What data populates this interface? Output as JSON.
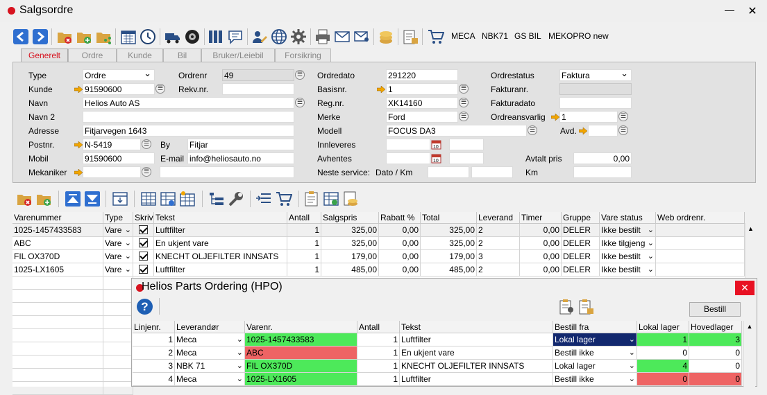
{
  "app": {
    "title": "Salgsordre",
    "min": "—",
    "close": "✕"
  },
  "toolbar": {
    "texts": [
      "MECA",
      "NBK71",
      "GS BIL",
      "MEKOPRO new"
    ]
  },
  "tabs": [
    "Generelt",
    "Ordre",
    "Kunde",
    "Bil",
    "Bruker/Leiebil",
    "Forsikring"
  ],
  "form": {
    "type_label": "Type",
    "type_value": "Ordre",
    "ordrenr_label": "Ordrenr",
    "ordrenr_value": "49",
    "kunde_label": "Kunde",
    "kunde_value": "91590600",
    "rekvnr_label": "Rekv.nr.",
    "rekvnr_value": "",
    "navn_label": "Navn",
    "navn_value": "Helios Auto AS",
    "navn2_label": "Navn 2",
    "navn2_value": "",
    "adresse_label": "Adresse",
    "adresse_value": "Fitjarvegen 1643",
    "postnr_label": "Postnr.",
    "postnr_value": "N-5419",
    "by_label": "By",
    "by_value": "Fitjar",
    "mobil_label": "Mobil",
    "mobil_value": "91590600",
    "email_label": "E-mail",
    "email_value": "info@heliosauto.no",
    "mekaniker_label": "Mekaniker",
    "mekaniker_value": "",
    "ordredato_label": "Ordredato",
    "ordredato_value": "291220",
    "basisnr_label": "Basisnr.",
    "basisnr_value": "1",
    "regnr_label": "Reg.nr.",
    "regnr_value": "XK14160",
    "merke_label": "Merke",
    "merke_value": "Ford",
    "modell_label": "Modell",
    "modell_value": "FOCUS DA3",
    "innleveres_label": "Innleveres",
    "avhentes_label": "Avhentes",
    "neste_label": "Neste service:",
    "neste_sub": "Dato / Km",
    "ordrestatus_label": "Ordrestatus",
    "ordrestatus_value": "Faktura",
    "fakturanr_label": "Fakturanr.",
    "fakturanr_value": "",
    "fakturadato_label": "Fakturadato",
    "fakturadato_value": "",
    "ordreansvarlig_label": "Ordreansvarlig",
    "ordreansvarlig_value": "1",
    "avd_label": "Avd.",
    "avd_value": "",
    "avtalt_label": "Avtalt pris",
    "avtalt_value": "0,00",
    "km_label": "Km",
    "km_value": ""
  },
  "grid": {
    "headers": [
      "Varenummer",
      "Type",
      "Skriv",
      "Tekst",
      "Antall",
      "Salgspris",
      "Rabatt %",
      "Total",
      "Leverand",
      "Timer",
      "Gruppe",
      "Vare status",
      "Web ordrenr."
    ],
    "rows": [
      [
        "1025-1457433583",
        "Vare",
        "",
        "Luftfilter",
        "1",
        "325,00",
        "0,00",
        "325,00",
        "2",
        "0,00",
        "DELER",
        "Ikke bestilt",
        ""
      ],
      [
        "ABC",
        "Vare",
        "",
        "En ukjent vare",
        "1",
        "325,00",
        "0,00",
        "325,00",
        "2",
        "0,00",
        "DELER",
        "Ikke tilgjeng",
        ""
      ],
      [
        "FIL OX370D",
        "Vare",
        "",
        "KNECHT OLJEFILTER INNSATS",
        "1",
        "179,00",
        "0,00",
        "179,00",
        "3",
        "0,00",
        "DELER",
        "Ikke bestilt",
        ""
      ],
      [
        "1025-LX1605",
        "Vare",
        "",
        "Luftfilter",
        "1",
        "485,00",
        "0,00",
        "485,00",
        "2",
        "0,00",
        "DELER",
        "Ikke bestilt",
        ""
      ]
    ]
  },
  "hpo": {
    "title": "Helios Parts Ordering (HPO)",
    "close": "✕",
    "help": "?",
    "bestill": "Bestill",
    "headers": [
      "Linjenr.",
      "Leverandør",
      "Varenr.",
      "Antall",
      "Tekst",
      "Bestill fra",
      "Lokal lager",
      "Hovedlager"
    ],
    "rows": [
      [
        "1",
        "Meca",
        "1025-1457433583",
        "1",
        "Luftfilter",
        "Lokal lager",
        "1",
        "3"
      ],
      [
        "2",
        "Meca",
        "ABC",
        "1",
        "En ukjent vare",
        "Bestill ikke",
        "0",
        "0"
      ],
      [
        "3",
        "NBK 71",
        "FIL OX370D",
        "1",
        "KNECHT OLJEFILTER INNSATS",
        "Lokal lager",
        "4",
        "0"
      ],
      [
        "4",
        "Meca",
        "1025-LX1605",
        "1",
        "Luftfilter",
        "Bestill ikke",
        "0",
        "0"
      ]
    ],
    "colors": {
      "green": "#4de95a",
      "red": "#ee6464",
      "selected": "#12286e"
    }
  }
}
